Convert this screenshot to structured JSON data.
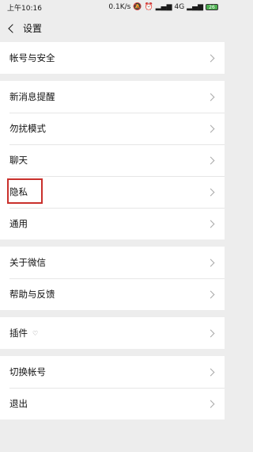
{
  "status_bar": {
    "time": "上午10:16",
    "net_speed": "0.1K/s",
    "network": "4G",
    "battery": "26"
  },
  "header": {
    "title": "设置"
  },
  "groups": [
    [
      {
        "label": "帐号与安全"
      }
    ],
    [
      {
        "label": "新消息提醒"
      },
      {
        "label": "勿扰模式"
      },
      {
        "label": "聊天"
      },
      {
        "label": "隐私",
        "highlighted": true
      },
      {
        "label": "通用"
      }
    ],
    [
      {
        "label": "关于微信"
      },
      {
        "label": "帮助与反馈"
      }
    ],
    [
      {
        "label": "插件"
      }
    ],
    [
      {
        "label": "切换帐号"
      },
      {
        "label": "退出"
      }
    ]
  ],
  "colors": {
    "background": "#ededed",
    "highlight": "#c9302c"
  }
}
